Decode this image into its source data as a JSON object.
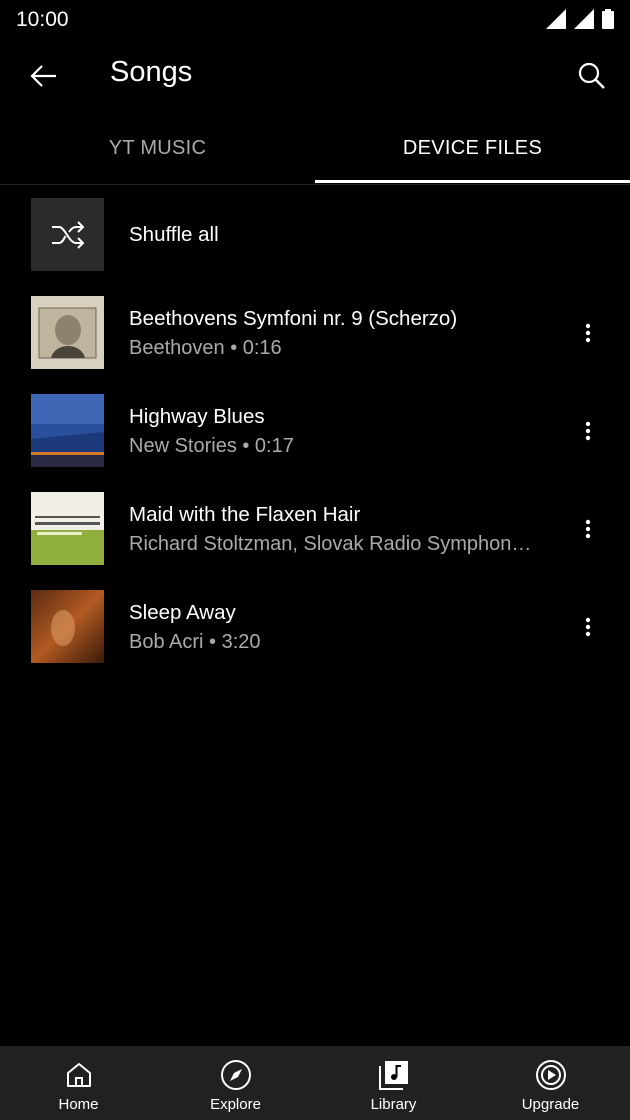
{
  "status": {
    "time": "10:00"
  },
  "header": {
    "title": "Songs"
  },
  "tabs": [
    {
      "label": "YT MUSIC"
    },
    {
      "label": "DEVICE FILES"
    }
  ],
  "shuffle": {
    "label": "Shuffle all"
  },
  "songs": [
    {
      "title": "Beethovens Symfoni nr. 9 (Scherzo)",
      "subtitle": "Beethoven • 0:16"
    },
    {
      "title": "Highway Blues",
      "subtitle": "New Stories • 0:17"
    },
    {
      "title": "Maid with the Flaxen Hair",
      "subtitle": "Richard Stoltzman, Slovak Radio Symphon…"
    },
    {
      "title": "Sleep Away",
      "subtitle": "Bob Acri • 3:20"
    }
  ],
  "nav": [
    {
      "label": "Home",
      "icon": "home-icon"
    },
    {
      "label": "Explore",
      "icon": "compass-icon"
    },
    {
      "label": "Library",
      "icon": "library-icon"
    },
    {
      "label": "Upgrade",
      "icon": "play-circle-icon"
    }
  ],
  "colors": {
    "background": "#000000",
    "secondary_text": "#aaaaaa",
    "nav_background": "#212121"
  }
}
